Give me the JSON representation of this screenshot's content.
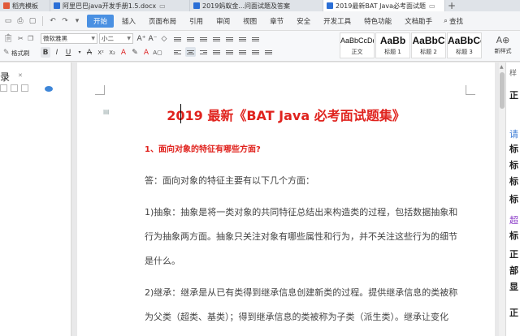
{
  "tabs": [
    {
      "label": "稻壳模板",
      "icon": "template-icon",
      "active": false
    },
    {
      "label": "阿里巴巴java开发手册1.5.docx",
      "icon": "word-doc-icon",
      "active": false
    },
    {
      "label": "2019蚂蚁金...问面试题及答案",
      "icon": "word-doc-icon",
      "active": false
    },
    {
      "label": "2019最新BAT Java必考面试题",
      "icon": "word-doc-icon",
      "active": true
    }
  ],
  "menu": {
    "items": [
      "开始",
      "插入",
      "页面布局",
      "引用",
      "审阅",
      "视图",
      "章节",
      "安全",
      "开发工具",
      "特色功能",
      "文档助手"
    ],
    "active": "开始",
    "search_label": "查找"
  },
  "ribbon": {
    "format_painter": "格式刷",
    "font_name": "微软雅黑",
    "font_size": "小二",
    "styles": [
      {
        "preview": "AaBbCcDd",
        "name": "正文"
      },
      {
        "preview": "AaBb",
        "name": "标题 1"
      },
      {
        "preview": "AaBbC",
        "name": "标题 2"
      },
      {
        "preview": "AaBbCc",
        "name": "标题 3"
      }
    ],
    "new_style": "新样式"
  },
  "left_pane": {
    "title": "录"
  },
  "document": {
    "title": "2019 最新《BAT Java 必考面试题集》",
    "heading": "1、面向对象的特征有哪些方面?",
    "lines": [
      "答：面向对象的特征主要有以下几个方面：",
      "1)抽象：抽象是将一类对象的共同特征总结出来构造类的过程，包括数据抽象和",
      "行为抽象两方面。抽象只关注对象有哪些属性和行为，并不关注这些行为的细节",
      "是什么。",
      "2)继承：继承是从已有类得到继承信息创建新类的过程。提供继承信息的类被称",
      "为父类（超类、基类）；得到继承信息的类被称为子类（派生类）。继承让变化"
    ]
  },
  "right_pane": {
    "chars": [
      "样",
      "正",
      "请",
      "标",
      "标",
      "标",
      "标",
      "超",
      "标",
      "正",
      "部",
      "显",
      "正"
    ]
  },
  "colors": {
    "title_red": "#e0231e",
    "accent_blue": "#4a90e2"
  }
}
